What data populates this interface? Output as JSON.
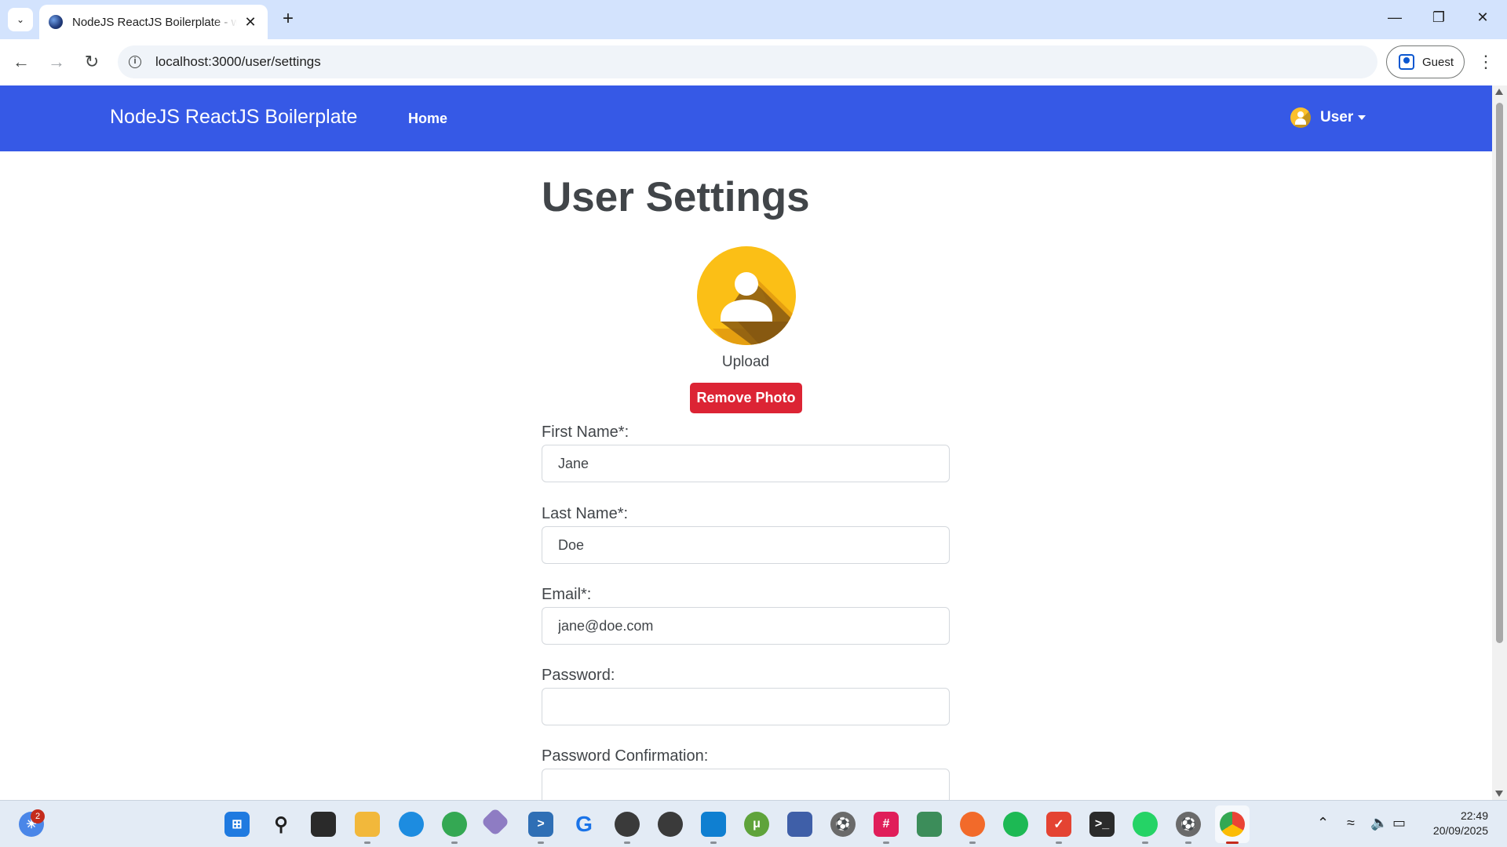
{
  "browser": {
    "tab_title": "NodeJS ReactJS Boilerplate - w",
    "url": "localhost:3000/user/settings",
    "profile_label": "Guest"
  },
  "navbar": {
    "brand": "NodeJS ReactJS Boilerplate",
    "home_label": "Home",
    "user_label": "User",
    "bg_color": "#3659e6"
  },
  "page": {
    "title": "User Settings",
    "upload_label": "Upload",
    "remove_photo_label": "Remove Photo",
    "fields": {
      "first_name": {
        "label": "First Name*:",
        "value": "Jane"
      },
      "last_name": {
        "label": "Last Name*:",
        "value": "Doe"
      },
      "email": {
        "label": "Email*:",
        "value": "jane@doe.com"
      },
      "password": {
        "label": "Password:",
        "value": ""
      },
      "password_confirmation": {
        "label": "Password Confirmation:",
        "value": ""
      }
    }
  },
  "taskbar": {
    "notification_count": "2",
    "time": "22:49",
    "date": "20/09/2025",
    "apps": [
      "widgets-icon",
      "windows-start-icon",
      "search-icon",
      "task-view-icon",
      "file-explorer-icon",
      "docker-icon",
      "chrome-profile-icon",
      "git-icon",
      "powershell-icon",
      "logitech-icon",
      "chatgpt-icon",
      "openai-icon",
      "vscode-icon",
      "utorrent-icon",
      "network-icon",
      "soccer-icon",
      "slack-icon",
      "translator-icon",
      "compass-icon",
      "spotify-icon",
      "todoist-icon",
      "terminal-icon",
      "whatsapp-icon",
      "soccer-manager-icon",
      "chrome-icon"
    ]
  }
}
